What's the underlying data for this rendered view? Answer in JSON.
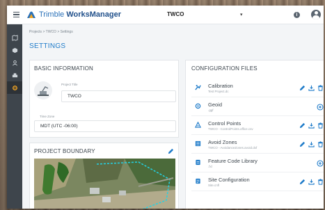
{
  "app": {
    "brand_prefix": "Trimble ",
    "brand_name": "WorksManager",
    "project": "TWCO",
    "project_caret": "▾",
    "info_icon": "i"
  },
  "colors": {
    "accent": "#1e7bc9",
    "rail": "#3e454c",
    "rail_active_icon": "#f5a623"
  },
  "rail": [
    {
      "icon": "map-icon"
    },
    {
      "icon": "box-icon"
    },
    {
      "icon": "user-icon"
    },
    {
      "icon": "machine-icon"
    },
    {
      "icon": "settings-icon",
      "active": true
    }
  ],
  "breadcrumb": "Projects > TWCO > Settings",
  "page_title": "SETTINGS",
  "basic_info": {
    "title": "BASIC INFORMATION",
    "project_title_label": "Project Title",
    "project_title_value": "TWCO",
    "time_zone_label": "Time Zone",
    "time_zone_value": "MDT (UTC -06:00)"
  },
  "boundary": {
    "title": "PROJECT BOUNDARY"
  },
  "config": {
    "title": "CONFIGURATION FILES",
    "items": [
      {
        "name": "Calibration",
        "file": "Test Project.dc",
        "icon": "calibration-icon",
        "actions": [
          "edit",
          "download",
          "delete"
        ]
      },
      {
        "name": "Geoid",
        "file": ".ggf",
        "icon": "geoid-icon",
        "actions": [
          "add"
        ]
      },
      {
        "name": "Control Points",
        "file": "TWCO - ControlPoints.office.csv",
        "icon": "control-points-icon",
        "actions": [
          "edit",
          "download",
          "delete"
        ]
      },
      {
        "name": "Avoid Zones",
        "file": "TWCO - AvoidanceZones.avoid.dxf",
        "icon": "avoid-zones-icon",
        "actions": [
          "edit",
          "download",
          "delete"
        ]
      },
      {
        "name": "Feature Code Library",
        "file": ".fxl",
        "icon": "feature-code-icon",
        "actions": [
          "add"
        ]
      },
      {
        "name": "Site Configuration",
        "file": "Site.cnfl",
        "icon": "site-config-icon",
        "actions": [
          "edit",
          "download",
          "delete"
        ]
      }
    ]
  }
}
